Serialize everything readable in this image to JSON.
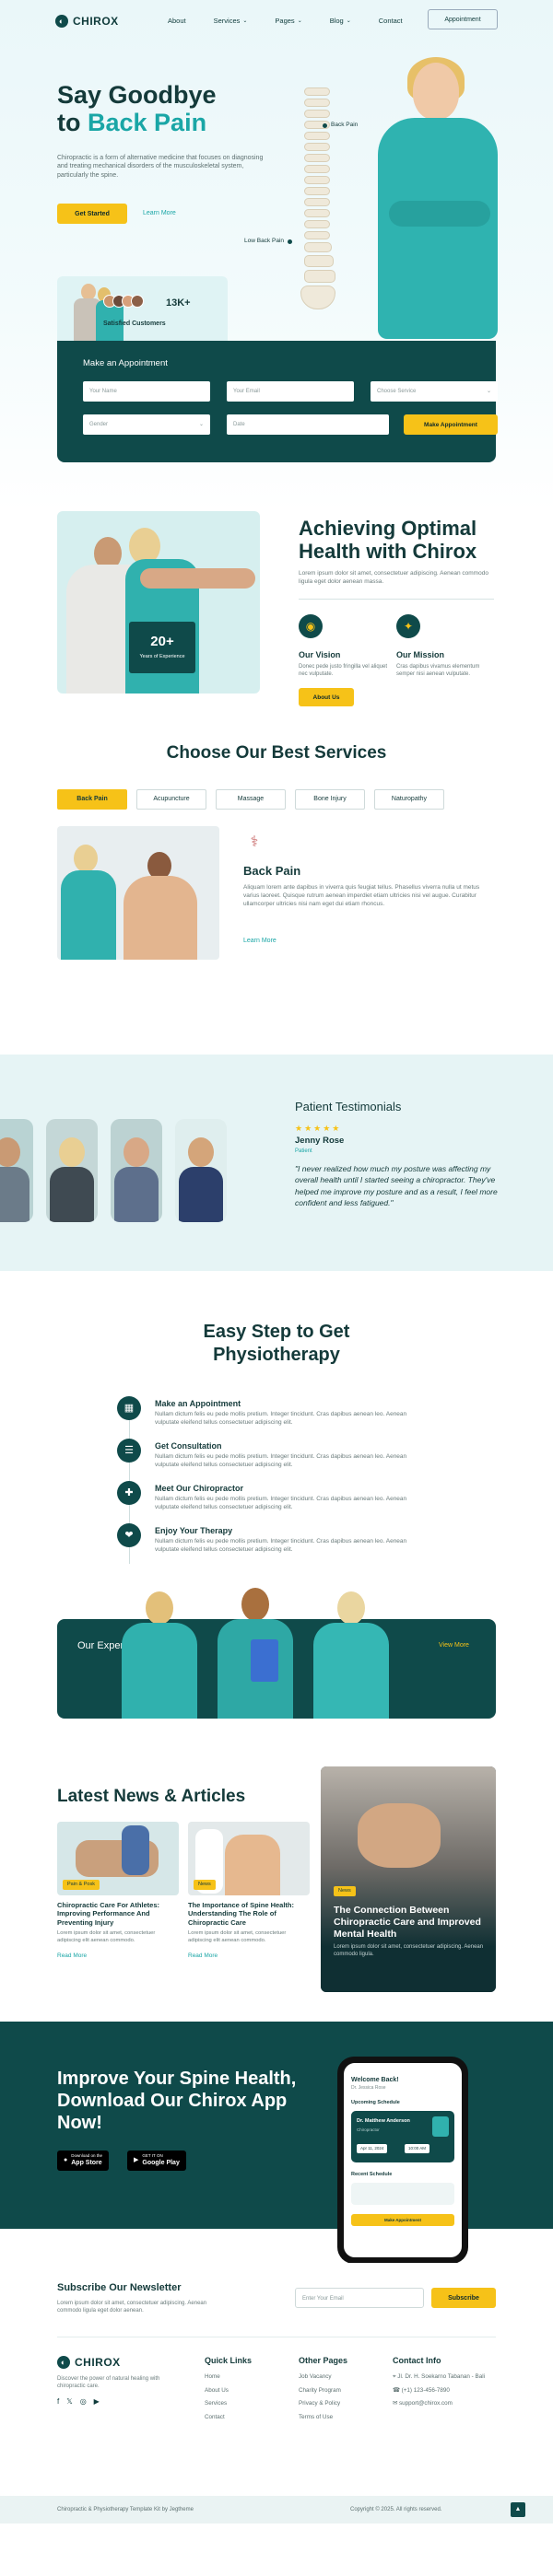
{
  "header": {
    "logo": "CHIROX",
    "nav": [
      "About",
      "Services",
      "Pages",
      "Blog",
      "Contact"
    ],
    "appointment_button": "Appointment"
  },
  "hero": {
    "title_line1": "Say Goodbye",
    "title_line2_prefix": "to ",
    "title_line2_highlight": "Back Pain",
    "paragraph": "Chiropractic is a form of alternative medicine that focuses on diagnosing and treating mechanical disorders of the musculoskeletal system, particularly the spine.",
    "get_started": "Get Started",
    "learn_more": "Learn More",
    "label_back_pain": "Back Pain",
    "label_low_back_pain": "Low Back Pain",
    "count": "13K+",
    "satisfied": "Satisfied Customers"
  },
  "appointment": {
    "title": "Make an Appointment",
    "name_placeholder": "Your Name",
    "email_placeholder": "Your Email",
    "service_placeholder": "Choose Service",
    "gender_placeholder": "Gender",
    "date_placeholder": "Date",
    "submit": "Make Appointment"
  },
  "achieving": {
    "title_line1": "Achieving Optimal",
    "title_line2": "Health with Chirox",
    "paragraph": "Lorem ipsum dolor sit amet, consectetuer adipiscing. Aenean commodo ligula eget dolor aenean massa.",
    "years_value": "20+",
    "years_label": "Years of Experience",
    "vision_title": "Our Vision",
    "vision_text": "Donec pede justo fringilla vel aliquet nec vulputate.",
    "mission_title": "Our Mission",
    "mission_text": "Cras dapibus vivamus elementum semper nisi aenean vulputate.",
    "about_button": "About Us"
  },
  "services": {
    "title": "Choose Our Best Services",
    "tabs": [
      "Back Pain",
      "Acupuncture",
      "Massage",
      "Bone Injury",
      "Naturopathy"
    ],
    "active_title": "Back Pain",
    "active_text": "Aliquam lorem ante dapibus in viverra quis feugiat tellus. Phasellus viverra nulla ut metus varius laoreet. Quisque rutrum aenean imperdiet etiam ultricies nisi vel augue. Curabitur ullamcorper ultricies nisi nam eget dui etiam rhoncus.",
    "learn_more": "Learn More"
  },
  "testimonials": {
    "title": "Patient Testimonials",
    "stars": "★★★★★",
    "name": "Jenny Rose",
    "role": "Patient",
    "quote": "\"I never realized how much my posture was affecting my overall health until I started seeing a chiropractor. They've helped me improve my posture and as a result, I feel more confident and less fatigued.\""
  },
  "steps": {
    "title_line1": "Easy Step to Get",
    "title_line2": "Physiotherapy",
    "items": [
      {
        "title": "Make an Appointment",
        "text": "Nullam dictum felis eu pede mollis pretium. Integer tincidunt. Cras dapibus aenean leo. Aenean vulputate eleifend tellus consectetuer adipiscing elit."
      },
      {
        "title": "Get Consultation",
        "text": "Nullam dictum felis eu pede mollis pretium. Integer tincidunt. Cras dapibus aenean leo. Aenean vulputate eleifend tellus consectetuer adipiscing elit."
      },
      {
        "title": "Meet Our Chiropractor",
        "text": "Nullam dictum felis eu pede mollis pretium. Integer tincidunt. Cras dapibus aenean leo. Aenean vulputate eleifend tellus consectetuer adipiscing elit."
      },
      {
        "title": "Enjoy Your Therapy",
        "text": "Nullam dictum felis eu pede mollis pretium. Integer tincidunt. Cras dapibus aenean leo. Aenean vulputate eleifend tellus consectetuer adipiscing elit."
      }
    ]
  },
  "experts": {
    "title": "Our Experts",
    "view_more": "View More"
  },
  "news": {
    "title": "Latest News & Articles",
    "cards": [
      {
        "tag": "Pain & Posk",
        "title": "Chiropractic Care For Athletes: Improving Performance And Preventing Injury",
        "text": "Lorem ipsum dolor sit amet, consectetuer adipiscing elit aenean commodo.",
        "more": "Read More"
      },
      {
        "tag": "News",
        "title": "The Importance of Spine Health: Understanding The Role of Chiropractic Care",
        "text": "Lorem ipsum dolor sit amet, consectetuer adipiscing elit aenean commodo.",
        "more": "Read More"
      }
    ],
    "featured": {
      "tag": "News",
      "title": "The Connection Between Chiropractic Care and Improved Mental Health",
      "text": "Lorem ipsum dolor sit amet, consectetuer adipiscing. Aenean commodo ligula."
    }
  },
  "app": {
    "title": "Improve Your Spine Health, Download Our Chirox App Now!",
    "appstore_small": "Download on the",
    "appstore": "App Store",
    "googleplay_small": "GET IT ON",
    "googleplay": "Google Play",
    "phone_welcome": "Welcome Back!",
    "phone_sub": "Dr. Jessica Rose",
    "phone_upcoming": "Upcoming Schedule",
    "phone_doctor": "Dr. Matthew Anderson",
    "phone_specialty": "Chiropractor",
    "phone_date": "Apr 11, 2024",
    "phone_time": "10:00 AM",
    "phone_recent": "Recent Schedule",
    "phone_button": "Make Appointment"
  },
  "newsletter": {
    "title": "Subscribe Our Newsletter",
    "text": "Lorem ipsum dolor sit amet, consectetuer adipiscing. Aenean commodo ligula eget dolor aenean.",
    "placeholder": "Enter Your Email",
    "button": "Subscribe"
  },
  "footer": {
    "logo": "CHIROX",
    "desc": "Discover the power of natural healing with chiropractic care.",
    "quick_links_title": "Quick Links",
    "quick_links": [
      "Home",
      "About Us",
      "Services",
      "Contact"
    ],
    "other_pages_title": "Other Pages",
    "other_pages": [
      "Job Vacancy",
      "Charity Program",
      "Privacy & Policy",
      "Terms of Use"
    ],
    "contact_title": "Contact Info",
    "contact": [
      "Jl. Dr. H. Soekarno Tabanan - Bali",
      "(+1) 123-456-7890",
      "support@chirox.com"
    ],
    "bottom_left": "Chiropractic & Physiotherapy Template Kit by Jegtheme",
    "bottom_right": "Copyright © 2025. All rights reserved.",
    "to_top": "▲"
  },
  "colors": {
    "primary": "#0f4a4a",
    "accent": "#f6c218",
    "highlight": "#1aa6a6"
  }
}
